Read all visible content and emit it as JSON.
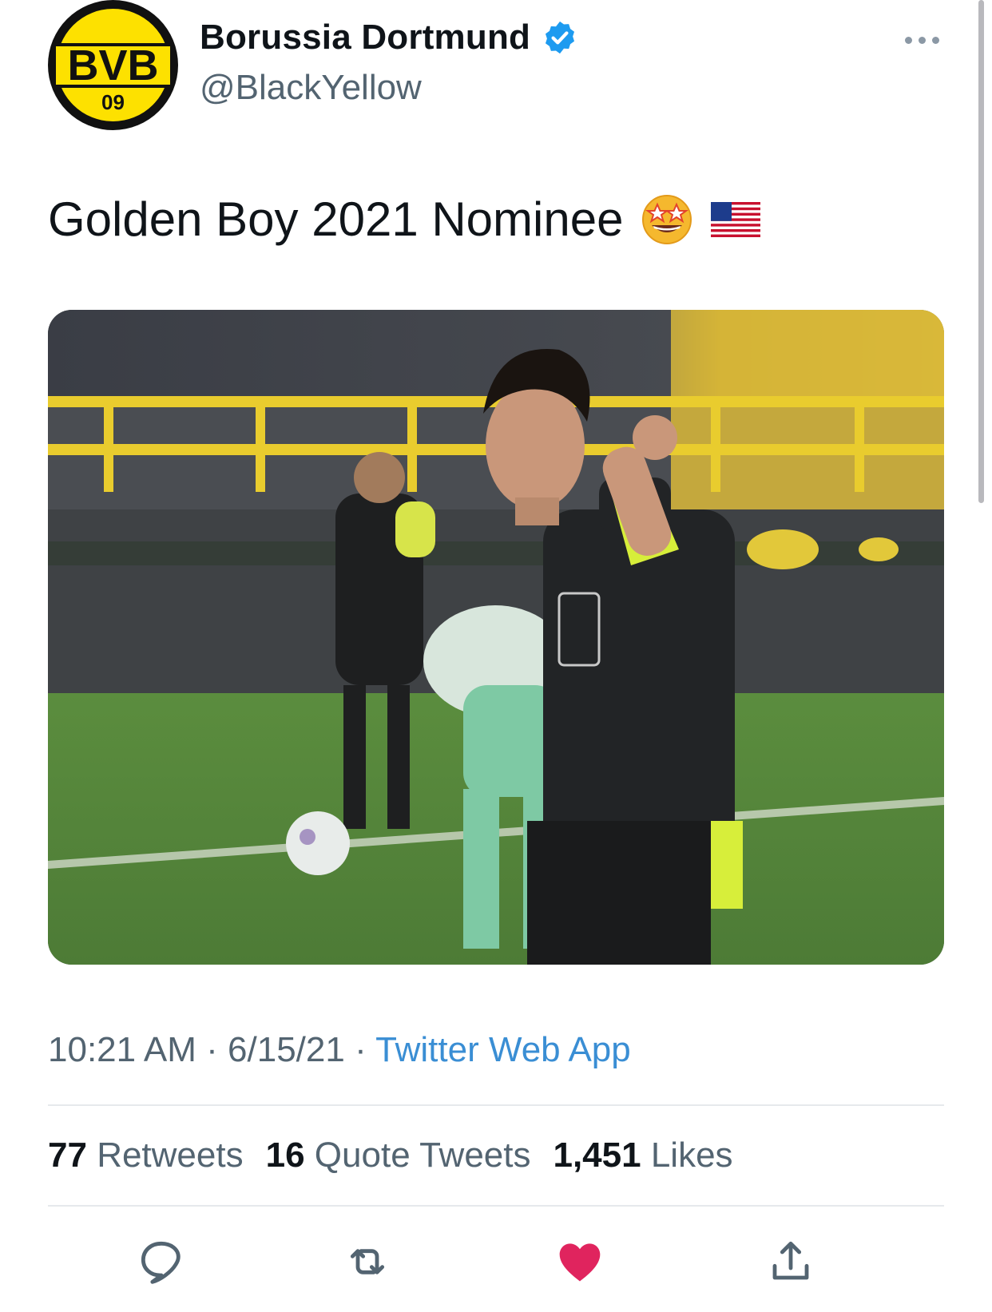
{
  "tweet": {
    "avatar_letters": "BVB",
    "avatar_number": "09",
    "display_name": "Borussia Dortmund",
    "handle": "@BlackYellow",
    "text": "Golden Boy 2021 Nominee",
    "emojis": [
      "star-struck-emoji",
      "us-flag-emoji"
    ],
    "time": "10:21 AM",
    "date": "6/15/21",
    "source": "Twitter Web App",
    "separator": "·"
  },
  "stats": {
    "retweets_count": "77",
    "retweets_label": "Retweets",
    "quotes_count": "16",
    "quotes_label": "Quote Tweets",
    "likes_count": "1,451",
    "likes_label": "Likes"
  },
  "actions": [
    "reply-icon",
    "retweet-icon",
    "like-icon",
    "share-icon"
  ],
  "colors": {
    "brand_yellow": "#fde100",
    "verified_blue": "#1d9bf0",
    "link_blue": "#3a8ed4",
    "like_red": "#e0245e",
    "secondary_text": "#536471"
  }
}
